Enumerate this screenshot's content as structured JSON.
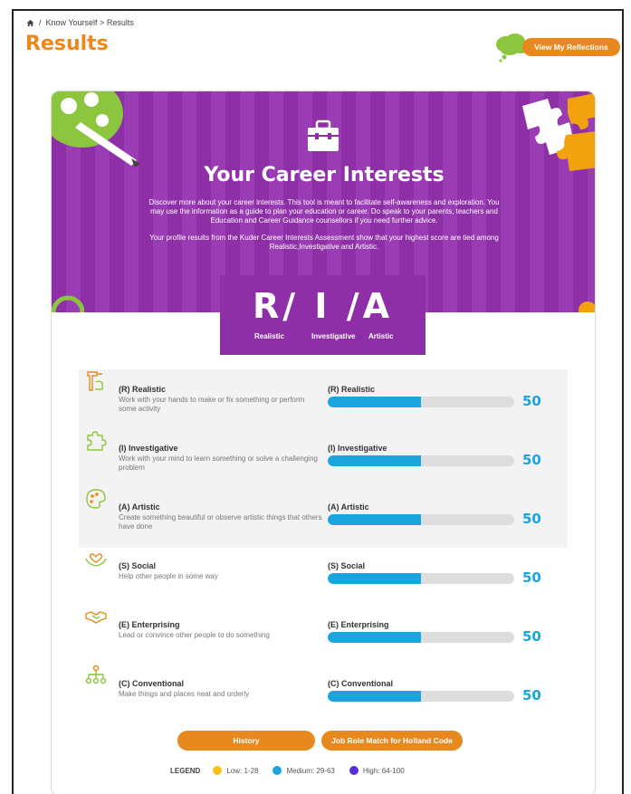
{
  "breadcrumb": {
    "sep": "/",
    "path": "Know Yourself > Results"
  },
  "page": {
    "title": "Results"
  },
  "reflections_button": "View My Reflections",
  "hero": {
    "title": "Your Career Interests",
    "paragraph1": "Discover more about your career interests. This tool is meant to facilitate self-awareness and exploration. You may use the information as a guide to plan your education or career. Do speak to your parents, teachers and Education and Career Guidance counsellors if you need further advice.",
    "paragraph2": "Your profile results from the Kuder Career Interests Assessment show that your highest score are tied among Realistic,Investigative and Artistic."
  },
  "code": {
    "letters": "R/ I /A",
    "labels": [
      "Realistic",
      "Investigative",
      "Artistic"
    ]
  },
  "interests": [
    {
      "name": "(R) Realistic",
      "description": "Work with your hands to make or fix something or perform some activity",
      "bar_label": "(R) Realistic",
      "score": "50",
      "fill": 0.5,
      "icon": "hand-tool-icon",
      "highlighted": true
    },
    {
      "name": "(I) Investigative",
      "description": "Work with your mind to learn something or solve a challenging problem",
      "bar_label": "(I) Investigative",
      "score": "50",
      "fill": 0.5,
      "icon": "puzzle-icon",
      "highlighted": true
    },
    {
      "name": "(A) Artistic",
      "description": "Create something beautiful or observe artistic things that others have done",
      "bar_label": "(A) Artistic",
      "score": "50",
      "fill": 0.5,
      "icon": "palette-icon",
      "highlighted": true
    },
    {
      "name": "(S) Social",
      "description": "Help other people in some way",
      "bar_label": "(S) Social",
      "score": "50",
      "fill": 0.5,
      "icon": "hands-heart-icon",
      "highlighted": false
    },
    {
      "name": "(E) Enterprising",
      "description": "Lead or convince other people to do something",
      "bar_label": "(E) Enterprising",
      "score": "50",
      "fill": 0.5,
      "icon": "handshake-icon",
      "highlighted": false
    },
    {
      "name": "(C) Conventional",
      "description": "Make things and places neat and orderly",
      "bar_label": "(C) Conventional",
      "score": "50",
      "fill": 0.5,
      "icon": "org-chart-icon",
      "highlighted": false
    }
  ],
  "buttons": {
    "history": "History",
    "job_match": "Job Role Match for Holland Code"
  },
  "legend": {
    "title": "LEGEND",
    "items": [
      {
        "label": "Low: 1-28",
        "color": "#f5c518"
      },
      {
        "label": "Medium: 29-63",
        "color": "#1aa5de"
      },
      {
        "label": "High: 64-100",
        "color": "#5b2fd6"
      }
    ]
  },
  "colors": {
    "accent": "#e8891f",
    "purple": "#8e2fa8",
    "bar": "#1aa5de"
  }
}
